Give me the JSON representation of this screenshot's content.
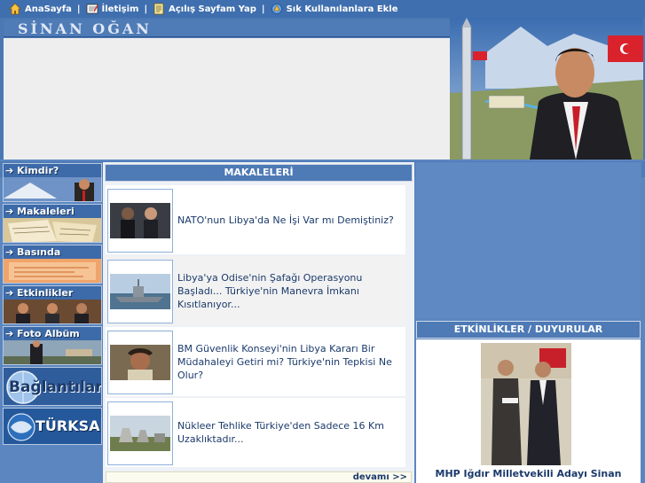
{
  "nav": {
    "items": [
      {
        "label": "AnaSayfa",
        "icon": "home-icon"
      },
      {
        "label": "İletişim",
        "icon": "contact-icon"
      },
      {
        "label": "Açılış Sayfam Yap",
        "icon": "homepage-icon"
      },
      {
        "label": "Sık Kullanılanlara Ekle",
        "icon": "favorites-icon"
      }
    ],
    "separator": "|"
  },
  "header": {
    "brand": "SİNAN OĞAN"
  },
  "sidebar": {
    "items": [
      {
        "label": "Kimdir?"
      },
      {
        "label": "Makaleleri"
      },
      {
        "label": "Basında"
      },
      {
        "label": "Etkinlikler"
      },
      {
        "label": "Foto Albüm"
      },
      {
        "label": "Bağlantılar"
      },
      {
        "label": "TÜRKSAM"
      }
    ]
  },
  "articles": {
    "title": "MAKALELERİ",
    "items": [
      {
        "text": "NATO'nun Libya'da Ne İşi Var mı Demiştiniz?"
      },
      {
        "text": "Libya'ya Odise'nin Şafağı Operasyonu Başladı... Türkiye'nin Manevra İmkanı Kısıtlanıyor..."
      },
      {
        "text": "BM Güvenlik Konseyi'nin Libya Kararı Bir Müdahaleyi Getiri mi? Türkiye'nin Tepkisi Ne Olur?"
      },
      {
        "text": "Nükleer Tehlike Türkiye'den Sadece 16 Km Uzaklıktadır..."
      }
    ],
    "more": "devamı >>"
  },
  "announcements": {
    "title": "ETKİNLİKLER / DUYURULAR",
    "caption": "MHP Iğdır Milletvekili Adayı Sinan"
  },
  "colors": {
    "nav_bg": "#3f6fae",
    "panel_header": "#4e7ab5",
    "page_bg": "#5b86c0",
    "article_text": "#1b3a6b"
  }
}
